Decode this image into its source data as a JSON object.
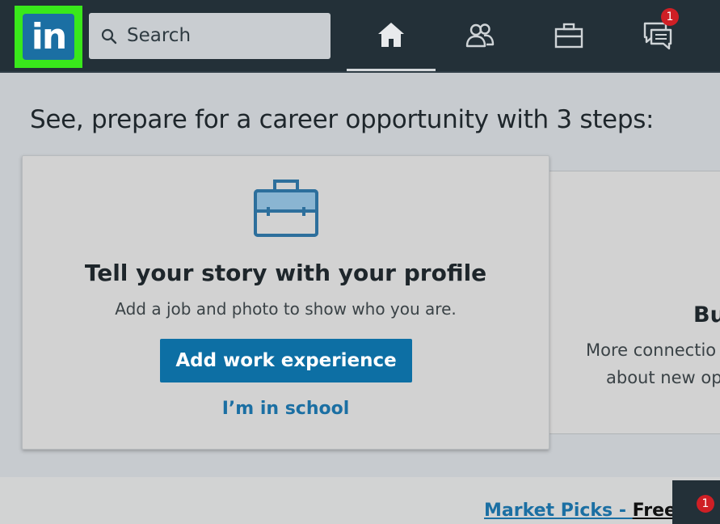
{
  "nav": {
    "logo_text": "in",
    "search": {
      "placeholder": "Search"
    },
    "items": [
      {
        "name": "home",
        "icon": "home-icon",
        "active": true
      },
      {
        "name": "my-network",
        "icon": "people-icon",
        "active": false
      },
      {
        "name": "jobs",
        "icon": "briefcase-icon",
        "active": false
      },
      {
        "name": "messaging",
        "icon": "chat-icon",
        "badge": "1",
        "active": false
      }
    ]
  },
  "main": {
    "heading": "See, prepare for a career opportunity with 3 steps:",
    "card": {
      "icon": "briefcase-icon",
      "title": "Tell your story with your profile",
      "subtitle": "Add a job and photo to show who you are.",
      "primary_button": "Add work experience",
      "secondary_link": "I’m in school"
    },
    "next_card": {
      "title": "Bu",
      "line1": "More connectio",
      "line2": "about new op"
    }
  },
  "footer": {
    "market_link": "Market Picks - ",
    "market_free": "Free",
    "dock_badge": "1"
  },
  "colors": {
    "nav_bg": "#233038",
    "logo_highlight": "#39e81b",
    "brand_blue": "#0d6fa4",
    "badge_red": "#cf1f25",
    "page_bg": "#c7cbcf"
  }
}
